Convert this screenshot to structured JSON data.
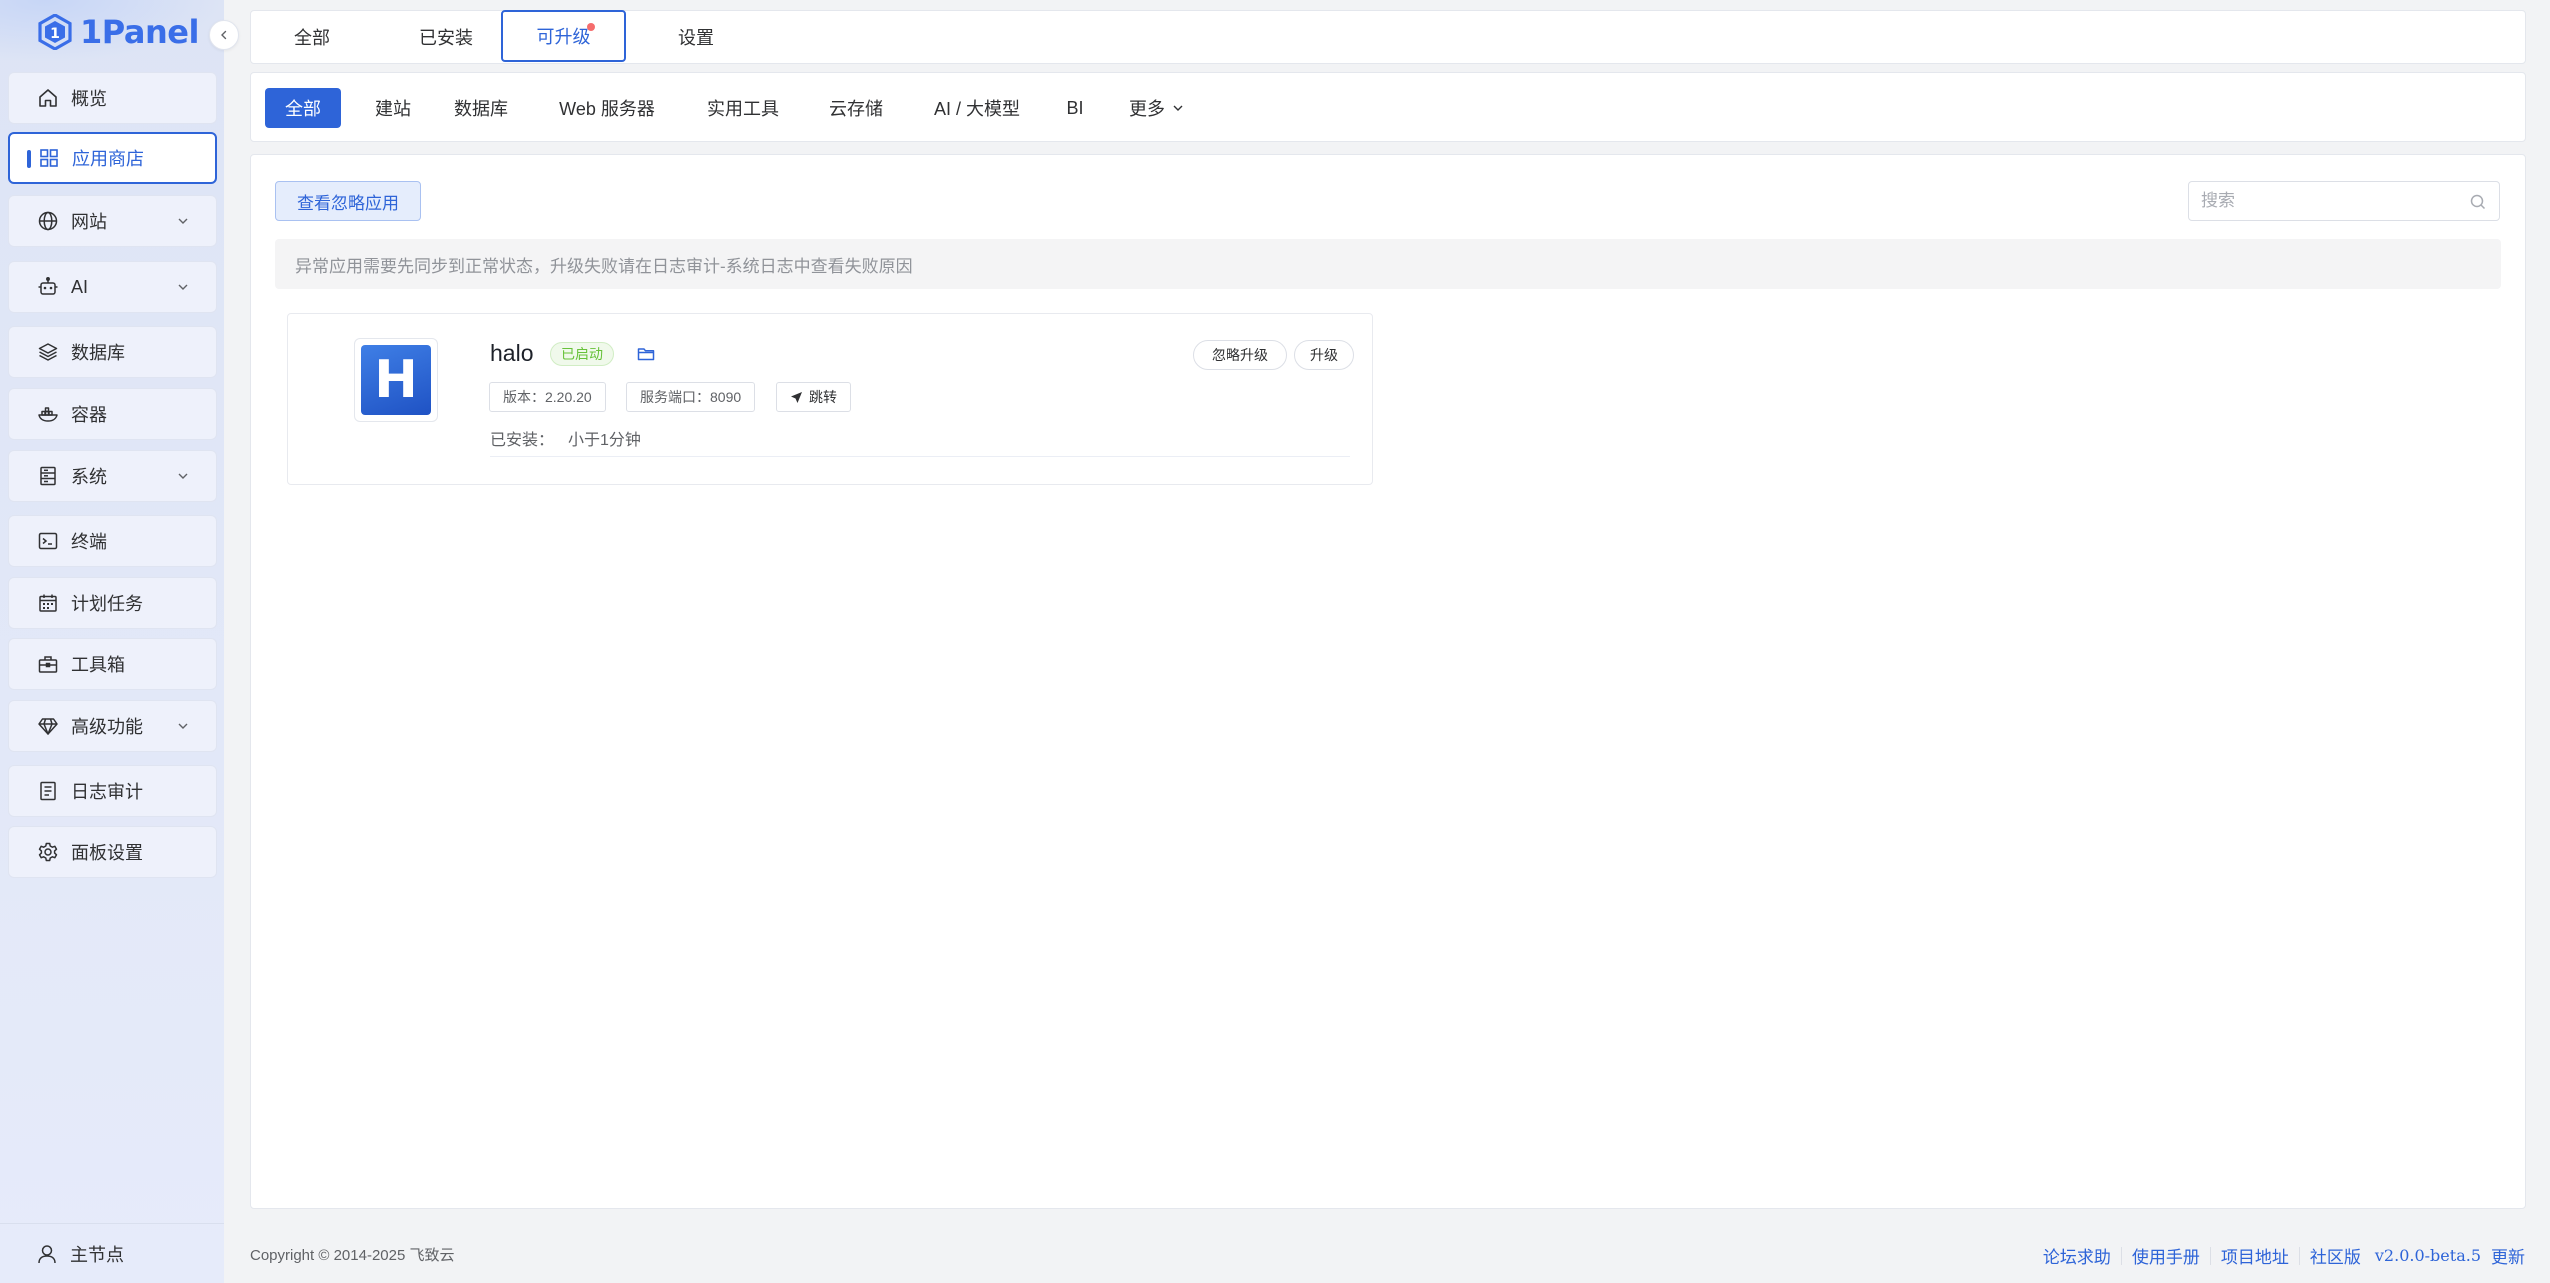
{
  "app": {
    "logo_text": "1Panel",
    "accent": "#2e64d8"
  },
  "sidebar": {
    "items": [
      {
        "label": "概览",
        "icon": "home-icon"
      },
      {
        "label": "应用商店",
        "icon": "grid-icon",
        "active": true
      },
      {
        "label": "网站",
        "icon": "globe-icon",
        "expandable": true
      },
      {
        "label": "AI",
        "icon": "robot-icon",
        "expandable": true
      },
      {
        "label": "数据库",
        "icon": "layers-icon"
      },
      {
        "label": "容器",
        "icon": "ship-icon"
      },
      {
        "label": "系统",
        "icon": "server-icon",
        "expandable": true
      },
      {
        "label": "终端",
        "icon": "terminal-icon"
      },
      {
        "label": "计划任务",
        "icon": "calendar-icon"
      },
      {
        "label": "工具箱",
        "icon": "toolbox-icon"
      },
      {
        "label": "高级功能",
        "icon": "diamond-icon",
        "expandable": true
      },
      {
        "label": "日志审计",
        "icon": "document-icon"
      },
      {
        "label": "面板设置",
        "icon": "gear-icon"
      }
    ],
    "footer_node": "主节点"
  },
  "top_tabs": [
    {
      "label": "全部"
    },
    {
      "label": "已安装"
    },
    {
      "label": "可升级",
      "active": true,
      "has_dot": true
    },
    {
      "label": "设置"
    }
  ],
  "categories": [
    {
      "label": "全部",
      "active": true
    },
    {
      "label": "建站"
    },
    {
      "label": "数据库"
    },
    {
      "label": "Web 服务器"
    },
    {
      "label": "实用工具"
    },
    {
      "label": "云存储"
    },
    {
      "label": "AI / 大模型"
    },
    {
      "label": "BI"
    },
    {
      "label": "更多"
    }
  ],
  "main": {
    "ignore_button": "查看忽略应用",
    "search_placeholder": "搜索",
    "notice": "异常应用需要先同步到正常状态，升级失败请在日志审计-系统日志中查看失败原因"
  },
  "app_card": {
    "icon_letter": "H",
    "name": "halo",
    "status": "已启动",
    "version_label": "版本：2.20.20",
    "port_label": "服务端口：8090",
    "jump_label": "跳转",
    "ignore_upgrade_label": "忽略升级",
    "upgrade_label": "升级",
    "installed_label": "已安装：",
    "installed_value": "小于1分钟"
  },
  "footer": {
    "copyright": "Copyright © 2014-2025 飞致云",
    "links": [
      "论坛求助",
      "使用手册",
      "项目地址",
      "社区版"
    ],
    "version": "v2.0.0-beta.5",
    "update": "更新"
  }
}
